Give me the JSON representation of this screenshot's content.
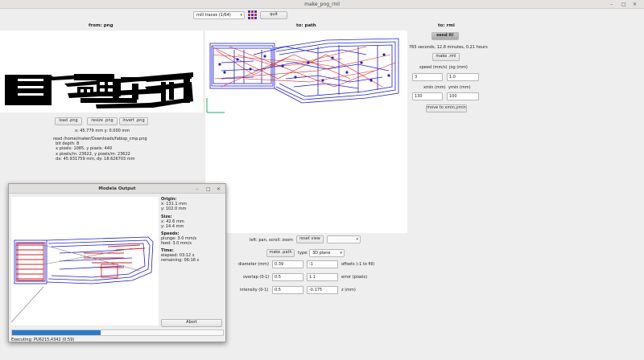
{
  "window": {
    "title": "make_png_rml"
  },
  "toolbar": {
    "process": "mill traces (1/64)",
    "quit": "quit"
  },
  "left": {
    "title": "from: png",
    "load": "load .png",
    "resize": "resize .png",
    "invert": "invert .png",
    "coords": "x: 45.779 mm  y: 0.000 mm",
    "info": [
      "read /home/maker/Downloads/fabisp_cmp.png",
      "  bit depth: 8",
      "  x pixels: 1085, y pixels: 440",
      "  x pixels/m: 23622, y pixels/m: 23622",
      "  dx: 45.931759 mm, dy: 18.626703 mm"
    ]
  },
  "middle": {
    "title": "to: path",
    "hint": "left: pan, scroll: zoom",
    "reset_view": "reset view",
    "view_select": "",
    "make_path": "make .path",
    "type_label": "type:",
    "type_value": "3D plane",
    "diameter_label": "diameter (mm)",
    "diameter_value": "0.39",
    "offsets_value": "-1",
    "offsets_label": "offsets (-1 to fill)",
    "overlap_label": "overlap (0-1)",
    "overlap_value": "0.5",
    "error_value": "1.1",
    "error_label": "error (pixels)",
    "intensity_label": "intensity (0-1)",
    "intensity_value": "0.5",
    "z_value": "-0.175",
    "z_label": "z (mm)"
  },
  "right": {
    "title": "to: rml",
    "send": "send it!",
    "time": "765 seconds, 12.8 minutes, 0.21 hours",
    "make_rml": "make .rml",
    "speed_label": "speed (mm/s)",
    "jog_label": "jog (mm)",
    "speed_value": "3",
    "jog_value": "1.0",
    "xmin_label": "xmin (mm)",
    "ymin_label": "ymin (mm)",
    "xmin_value": "130",
    "ymin_value": "100",
    "move_to": "move to xmin,ymin"
  },
  "modal": {
    "title": "Modela Output",
    "origin_h": "Origin:",
    "origin_x": "x: 131.1 mm",
    "origin_y": "y: 102.0 mm",
    "size_h": "Size:",
    "size_x": "x: 42.6 mm",
    "size_y": "y: 14.4 mm",
    "speeds_h": "Speeds:",
    "plunge": "plunge: 3.0 mm/s",
    "feed": "feed: 3.0 mm/s",
    "time_h": "Time:",
    "elapsed": "elapsed: 03:12 s",
    "remaining": "remaining: 06:16 s",
    "abort": "Abort",
    "status": "Executing: PU6215,4342 (0:59)",
    "progress": 0.42
  },
  "colors": {
    "cut_path": "#1f1fd8",
    "move_path": "#d81f1f",
    "progress": "#2e79c9"
  }
}
